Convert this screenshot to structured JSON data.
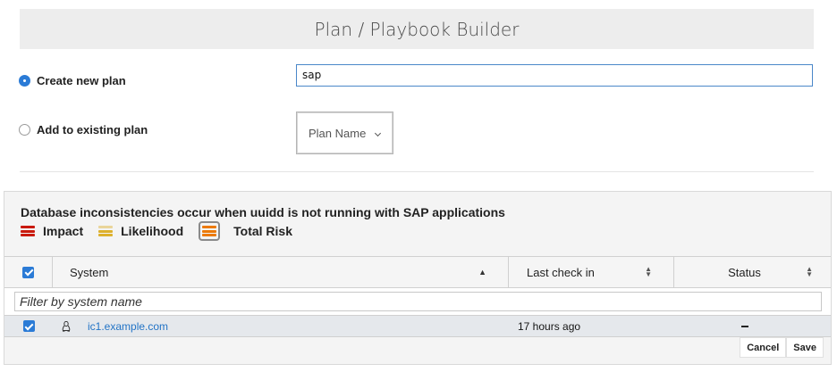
{
  "header": {
    "title": "Plan / Playbook Builder"
  },
  "plan_options": {
    "create_label": "Create new plan",
    "add_label": "Add to existing plan",
    "create_selected": true
  },
  "plan_name_input": {
    "value": "sap"
  },
  "plan_select": {
    "label": "Plan Name"
  },
  "rule": {
    "title": "Database inconsistencies occur when uuidd is not running with SAP applications",
    "legend": [
      {
        "label": "Impact",
        "color": "#c9190b"
      },
      {
        "label": "Likelihood",
        "color": "#ddb02c"
      },
      {
        "label": "Total Risk",
        "color": "#ec7a08"
      }
    ]
  },
  "table": {
    "columns": {
      "system": "System",
      "last_check_in": "Last check in",
      "status": "Status"
    },
    "filter_placeholder": "Filter by system name",
    "rows": [
      {
        "system": "ic1.example.com",
        "last_check_in": "17 hours ago",
        "os_icon": "linux-icon",
        "checked": true
      }
    ]
  },
  "actions": {
    "cancel_label": "Cancel",
    "save_label": "Save"
  },
  "colors": {
    "accent": "#2b7bd6",
    "link": "#2374c6"
  }
}
